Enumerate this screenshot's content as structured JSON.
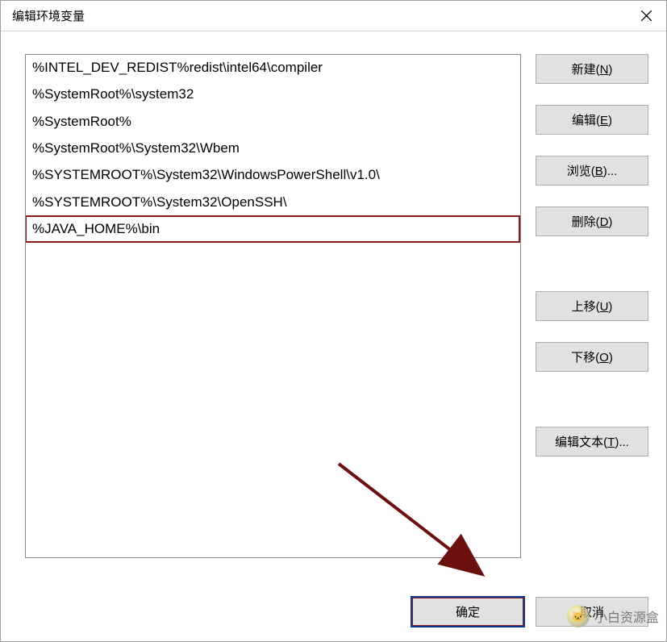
{
  "window": {
    "title": "编辑环境变量"
  },
  "list": {
    "items": [
      "%INTEL_DEV_REDIST%redist\\intel64\\compiler",
      "%SystemRoot%\\system32",
      "%SystemRoot%",
      "%SystemRoot%\\System32\\Wbem",
      "%SYSTEMROOT%\\System32\\WindowsPowerShell\\v1.0\\",
      "%SYSTEMROOT%\\System32\\OpenSSH\\",
      "%JAVA_HOME%\\bin"
    ],
    "highlighted_index": 6
  },
  "buttons": {
    "new": "新建(N)",
    "edit": "编辑(E)",
    "browse": "浏览(B)...",
    "delete": "删除(D)",
    "moveup": "上移(U)",
    "movedown": "下移(O)",
    "edittext": "编辑文本(T)...",
    "ok": "确定",
    "cancel": "取消"
  },
  "watermark": {
    "text": "小白资源盒"
  }
}
